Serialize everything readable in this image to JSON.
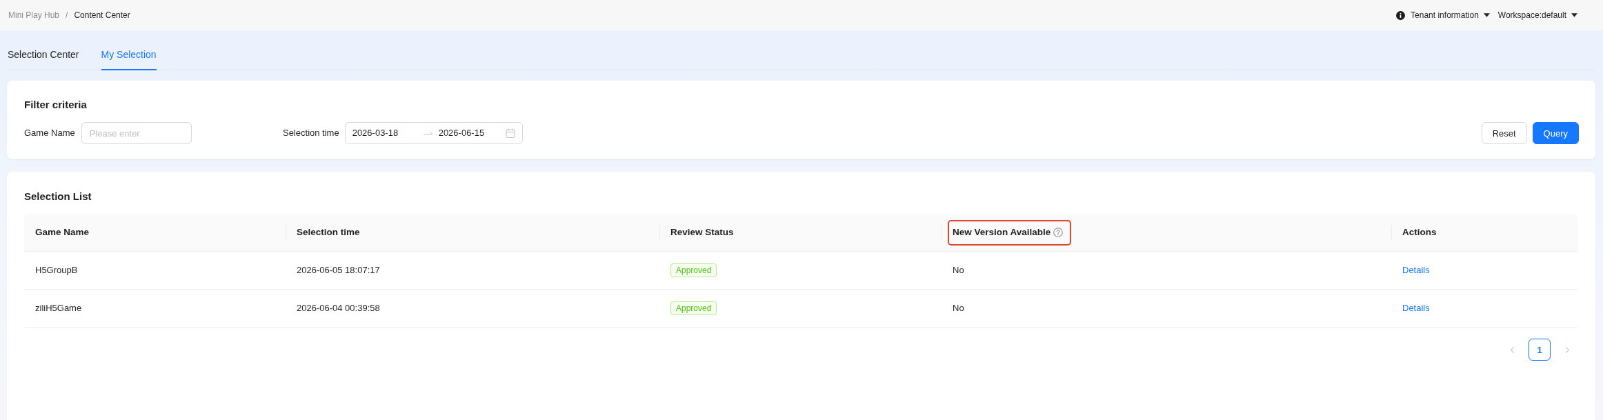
{
  "breadcrumb": [
    {
      "label": "Mini Play Hub",
      "current": false
    },
    {
      "label": "Content Center",
      "current": true
    }
  ],
  "breadcrumb_separator": "/",
  "header_menu": [
    {
      "kind": "info",
      "label": "Tenant information"
    },
    {
      "kind": "plain",
      "label": "Workspace:default"
    }
  ],
  "tabs": [
    {
      "label": "Selection Center",
      "selected": false
    },
    {
      "label": "My Selection",
      "selected": true
    }
  ],
  "filter": {
    "title": "Filter criteria",
    "fields": [
      {
        "kind": "text",
        "label": "Game Name",
        "placeholder": "Please enter"
      },
      {
        "kind": "date_range",
        "label": "Selection time",
        "start": "2026-03-18",
        "end": "2026-06-15"
      }
    ],
    "buttons": [
      {
        "label": "Reset",
        "primary": false
      },
      {
        "label": "Query",
        "primary": true
      }
    ]
  },
  "list": {
    "title": "Selection List",
    "columns": [
      {
        "label": "Game Name",
        "help": false,
        "highlighted": false
      },
      {
        "label": "Selection time",
        "help": false,
        "highlighted": false
      },
      {
        "label": "Review Status",
        "help": false,
        "highlighted": false
      },
      {
        "label": "New Version Available",
        "help": true,
        "highlighted": true
      },
      {
        "label": "Actions",
        "help": false,
        "highlighted": false
      }
    ],
    "rows": [
      {
        "game_name": "H5GroupB",
        "selection_time": "2026-06-05 18:07:17",
        "review_status": "Approved",
        "new_version": "No",
        "action": "Details"
      },
      {
        "game_name": "ziliH5Game",
        "selection_time": "2026-06-04 00:39:58",
        "review_status": "Approved",
        "new_version": "No",
        "action": "Details"
      }
    ],
    "pagination": {
      "prev_disabled": true,
      "next_disabled": true,
      "pages": [
        {
          "label": "1",
          "selected": true
        }
      ]
    }
  }
}
